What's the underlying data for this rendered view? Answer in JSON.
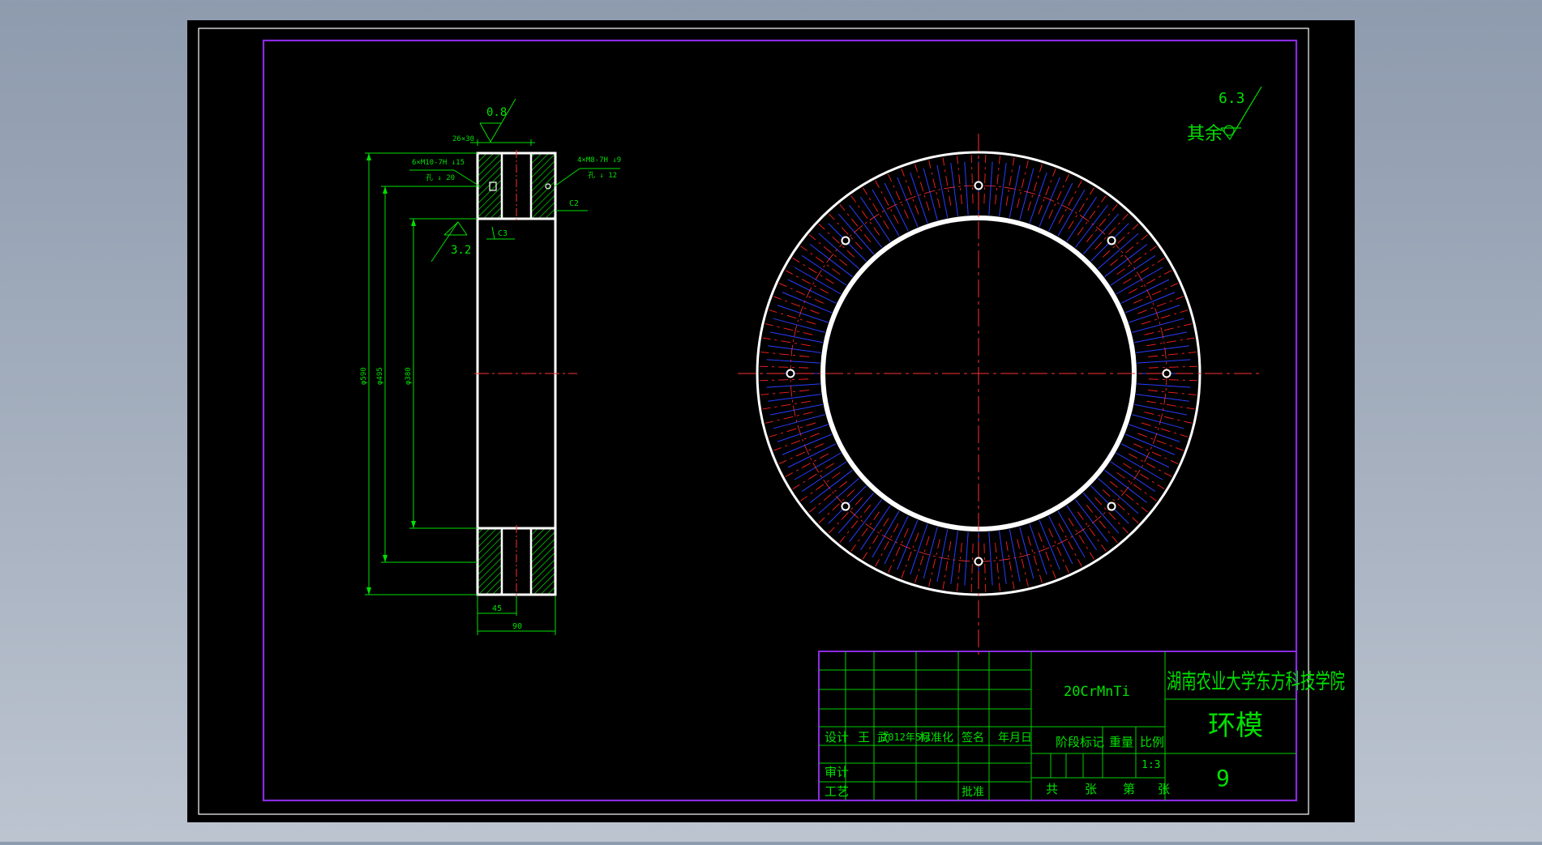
{
  "drawing": {
    "roughness": {
      "value": "0.8",
      "bore_value": "3.2",
      "general_label": "其余",
      "general_value": "6.3"
    },
    "section": {
      "top_dim": "26×30",
      "hole_left_line1": "6×M10-7H  ↓15",
      "hole_left_line2": "孔  ↓ 20",
      "hole_right_line1": "4×M8-7H  ↓9",
      "hole_right_line2": "孔 ↓ 12",
      "chamfer_right": "C2",
      "chamfer_inner": "C3",
      "dia_outer": "φ590",
      "dia_mid": "φ495",
      "dia_inner": "φ380",
      "dim_45": "45",
      "dim_90": "90"
    },
    "title_block": {
      "material": "20CrMnTi",
      "school": "湖南农业大学东方科技学院",
      "part_name": "环模",
      "drawing_no": "9",
      "scale": "1:3",
      "labels": {
        "design": "设计",
        "designer": "王 武",
        "date": "2012年5月",
        "standardization": "标准化",
        "signature": "签名",
        "ymd": "年月日",
        "stage_mark": "阶段标记",
        "weight": "重量",
        "ratio": "比例",
        "review": "审计",
        "craft": "工艺",
        "approve": "批准",
        "total": "共",
        "sheets": "张",
        "nth": "第",
        "sheet": "张"
      }
    }
  }
}
